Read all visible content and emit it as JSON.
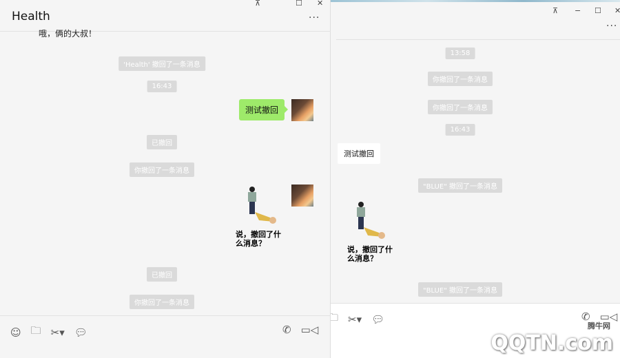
{
  "left_window": {
    "title": "Health",
    "controls": {
      "pin": "⊼",
      "maximize": "☐",
      "close": "✕"
    },
    "more": "···",
    "truncated_message": "哦，俩的大叔！",
    "messages": [
      {
        "type": "system",
        "text": "'Health' 撤回了一条消息"
      },
      {
        "type": "time",
        "text": "16:43"
      },
      {
        "type": "sent",
        "text": "测试撤回"
      },
      {
        "type": "system",
        "text": "已撤回"
      },
      {
        "type": "system",
        "text": "你撤回了一条消息"
      },
      {
        "type": "sticker",
        "text": "说，撤回了什么消息？"
      },
      {
        "type": "system",
        "text": "已撤回"
      },
      {
        "type": "system",
        "text": "你撤回了一条消息"
      }
    ],
    "toolbar": [
      "emoji-icon",
      "folder-icon",
      "scissors-icon",
      "chat-bubble-icon",
      "phone-icon",
      "video-icon"
    ]
  },
  "right_window": {
    "controls": {
      "pin": "⊼",
      "minimize": "−",
      "maximize": "☐",
      "close": "✕"
    },
    "more": "···",
    "messages": [
      {
        "type": "time",
        "text": "13:58"
      },
      {
        "type": "system",
        "text": "你撤回了一条消息"
      },
      {
        "type": "system",
        "text": "你撤回了一条消息"
      },
      {
        "type": "time",
        "text": "16:43"
      },
      {
        "type": "received",
        "text": "测试撤回"
      },
      {
        "type": "system",
        "text": "\"BLUE\" 撤回了一条消息"
      },
      {
        "type": "sticker",
        "text": "说，撤回了什么消息？"
      },
      {
        "type": "system",
        "text": "\"BLUE\" 撤回了一条消息"
      }
    ]
  },
  "watermark": {
    "brand": "QQTN.com",
    "cn": "腾牛网"
  }
}
